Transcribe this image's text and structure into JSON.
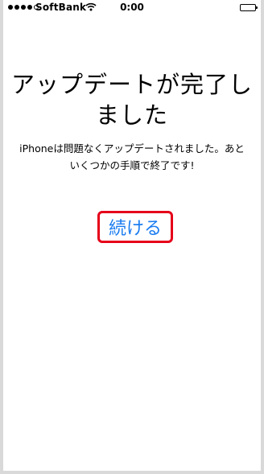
{
  "status_bar": {
    "carrier": "SoftBank",
    "time": "0:00",
    "signal_icon": "signal-dots-icon",
    "wifi_icon": "wifi-icon",
    "battery_icon": "battery-icon"
  },
  "content": {
    "title": "アップデートが完了しました",
    "message": "iPhoneは問題なくアップデートされました。あといくつかの手順で終了です!",
    "continue_label": "続ける"
  },
  "colors": {
    "link": "#1a7cf0",
    "highlight_border": "#e6001a"
  }
}
